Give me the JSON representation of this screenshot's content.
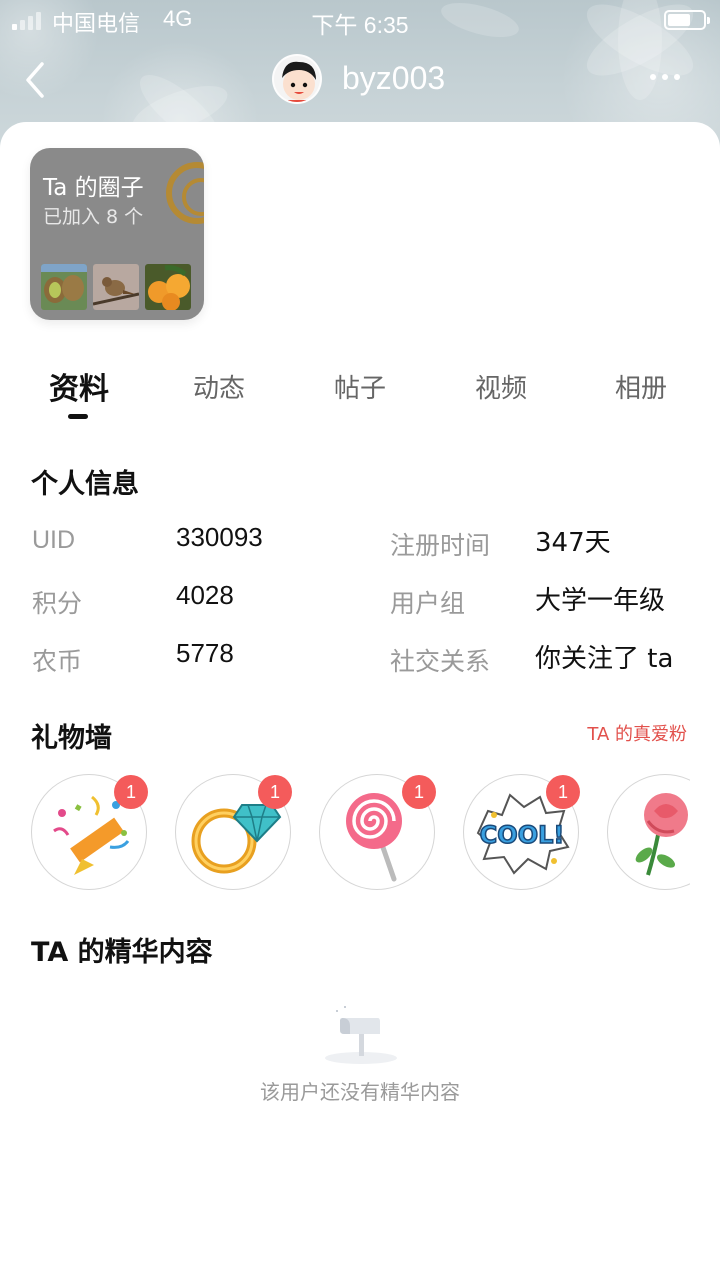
{
  "status_bar": {
    "carrier": "中国电信",
    "network": "4G",
    "time": "下午 6:35"
  },
  "nav": {
    "username": "byz003"
  },
  "circle_card": {
    "title": "Ta 的圈子",
    "subtitle": "已加入 8 个"
  },
  "tabs": [
    {
      "label": "资料",
      "active": true
    },
    {
      "label": "动态",
      "active": false
    },
    {
      "label": "帖子",
      "active": false
    },
    {
      "label": "视频",
      "active": false
    },
    {
      "label": "相册",
      "active": false
    }
  ],
  "profile": {
    "title": "个人信息",
    "fields": {
      "uid": {
        "label": "UID",
        "value": "330093"
      },
      "points": {
        "label": "积分",
        "value": "4028"
      },
      "coins": {
        "label": "农币",
        "value": "5778"
      },
      "registered": {
        "label": "注册时间",
        "value": "347天"
      },
      "user_group": {
        "label": "用户组",
        "value": "大学一年级"
      },
      "relation": {
        "label": "社交关系",
        "value": "你关注了 ta"
      }
    }
  },
  "gift_wall": {
    "title": "礼物墙",
    "fans_link": "TA 的真爱粉",
    "gifts": [
      {
        "icon": "party-popper-icon",
        "count": "1"
      },
      {
        "icon": "diamond-ring-icon",
        "count": "1"
      },
      {
        "icon": "lollipop-icon",
        "count": "1"
      },
      {
        "icon": "cool-sticker-icon",
        "count": "1"
      },
      {
        "icon": "rose-icon",
        "count": ""
      }
    ]
  },
  "highlights": {
    "title": "TA 的精华内容",
    "empty_text": "该用户还没有精华内容"
  },
  "colors": {
    "accent_red": "#f45b5b",
    "fans_link": "#e2514c",
    "circle_card_bg": "#8a8a8a"
  }
}
